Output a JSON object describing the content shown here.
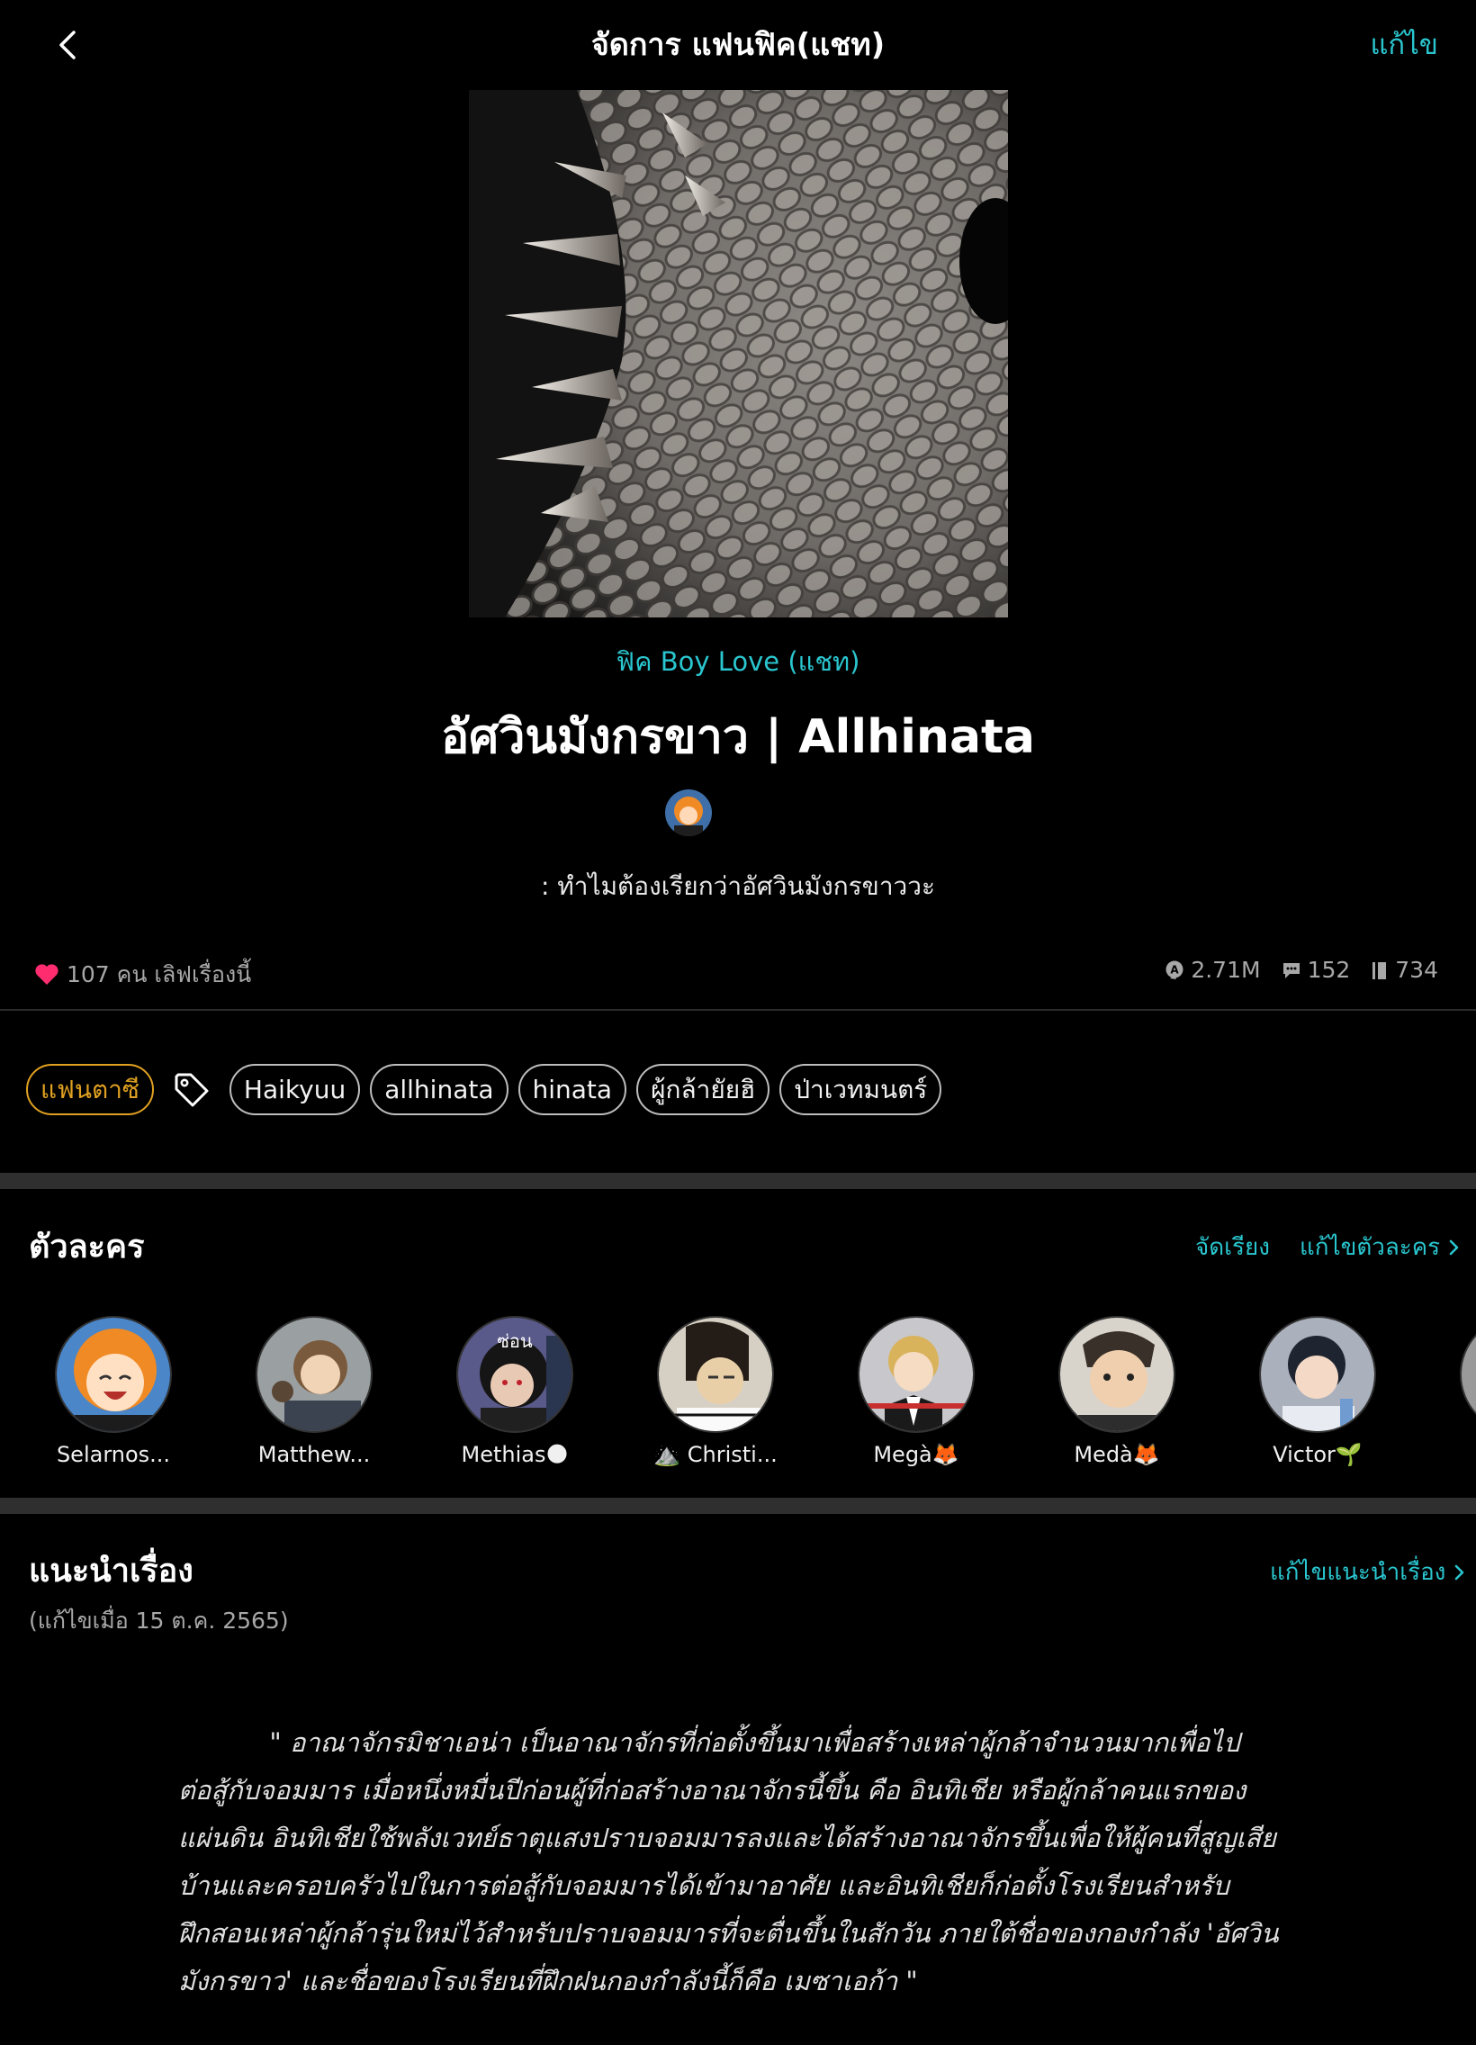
{
  "header": {
    "title": "จัดการ แฟนฟิค(แชท)",
    "edit_label": "แก้ไข"
  },
  "story": {
    "genre": "ฟิค Boy Love (แชท)",
    "title": "อัศวินมังกรขาว | Allhinata",
    "tagline": ": ทำไมต้องเรียกว่าอัศวินมังกรขาววะ"
  },
  "stats": {
    "likes_text": "107 คน เลิฟเรื่องนี้",
    "views": "2.71M",
    "comments": "152",
    "chapters": "734"
  },
  "tags": {
    "category": "แฟนตาซี",
    "items": [
      "Haikyuu",
      "allhinata",
      "hinata",
      "ผู้กล้ายัยฮิ",
      "ป่าเวทมนตร์"
    ]
  },
  "characters": {
    "heading": "ตัวละคร",
    "sort_label": "จัดเรียง",
    "edit_label": "แก้ไขตัวละคร",
    "hidden_label": "ซ่อน",
    "items": [
      {
        "name": "Selarnos...",
        "color": "#f08a24"
      },
      {
        "name": "Matthew...",
        "color": "#7a6a55"
      },
      {
        "name": "Methias🌑",
        "color": "#3a2a40"
      },
      {
        "name": "⛰️ Christi...",
        "color": "#4a4038"
      },
      {
        "name": "Megà🦊",
        "color": "#c9a24c"
      },
      {
        "name": "Medà🦊",
        "color": "#5a5048"
      },
      {
        "name": "Victor🌱",
        "color": "#2c3550"
      }
    ]
  },
  "intro": {
    "heading": "แนะนำเรื่อง",
    "edit_label": "แก้ไขแนะนำเรื่อง",
    "edited_text": "(แก้ไขเมื่อ 15 ต.ค. 2565)",
    "lines": [
      "           \" อาณาจักรมิชาเอน่า เป็นอาณาจักรที่ก่อตั้งขึ้นมาเพื่อสร้างเหล่าผู้กล้าจำนวนมากเพื่อไป",
      "ต่อสู้กับจอมมาร เมื่อหนึ่งหมื่นปีก่อนผู้ที่ก่อสร้างอาณาจักรนี้ขึ้น คือ อินทิเชีย หรือผู้กล้าคนแรกของ",
      "แผ่นดิน อินทิเชียใช้พลังเวทย์ธาตุแสงปราบจอมมารลงและได้สร้างอาณาจักรขึ้นเพื่อให้ผู้คนที่สูญเสีย",
      "บ้านและครอบครัวไปในการต่อสู้กับจอมมารได้เข้ามาอาศัย และอินทิเชียก็ก่อตั้งโรงเรียนสำหรับ",
      "ฝึกสอนเหล่าผู้กล้ารุ่นใหม่ไว้สำหรับปราบจอมมารที่จะตื่นขึ้นในสักวัน ภายใต้ชื่อของกองกำลัง 'อัศวิน",
      "มังกรขาว' และชื่อของโรงเรียนที่ฝึกฝนกองกำลังนี้ก็คือ เมซาเอก้า \""
    ]
  },
  "colors": {
    "accent": "#2ac6cf",
    "category": "#e0a021",
    "heart": "#ff2d6f"
  }
}
